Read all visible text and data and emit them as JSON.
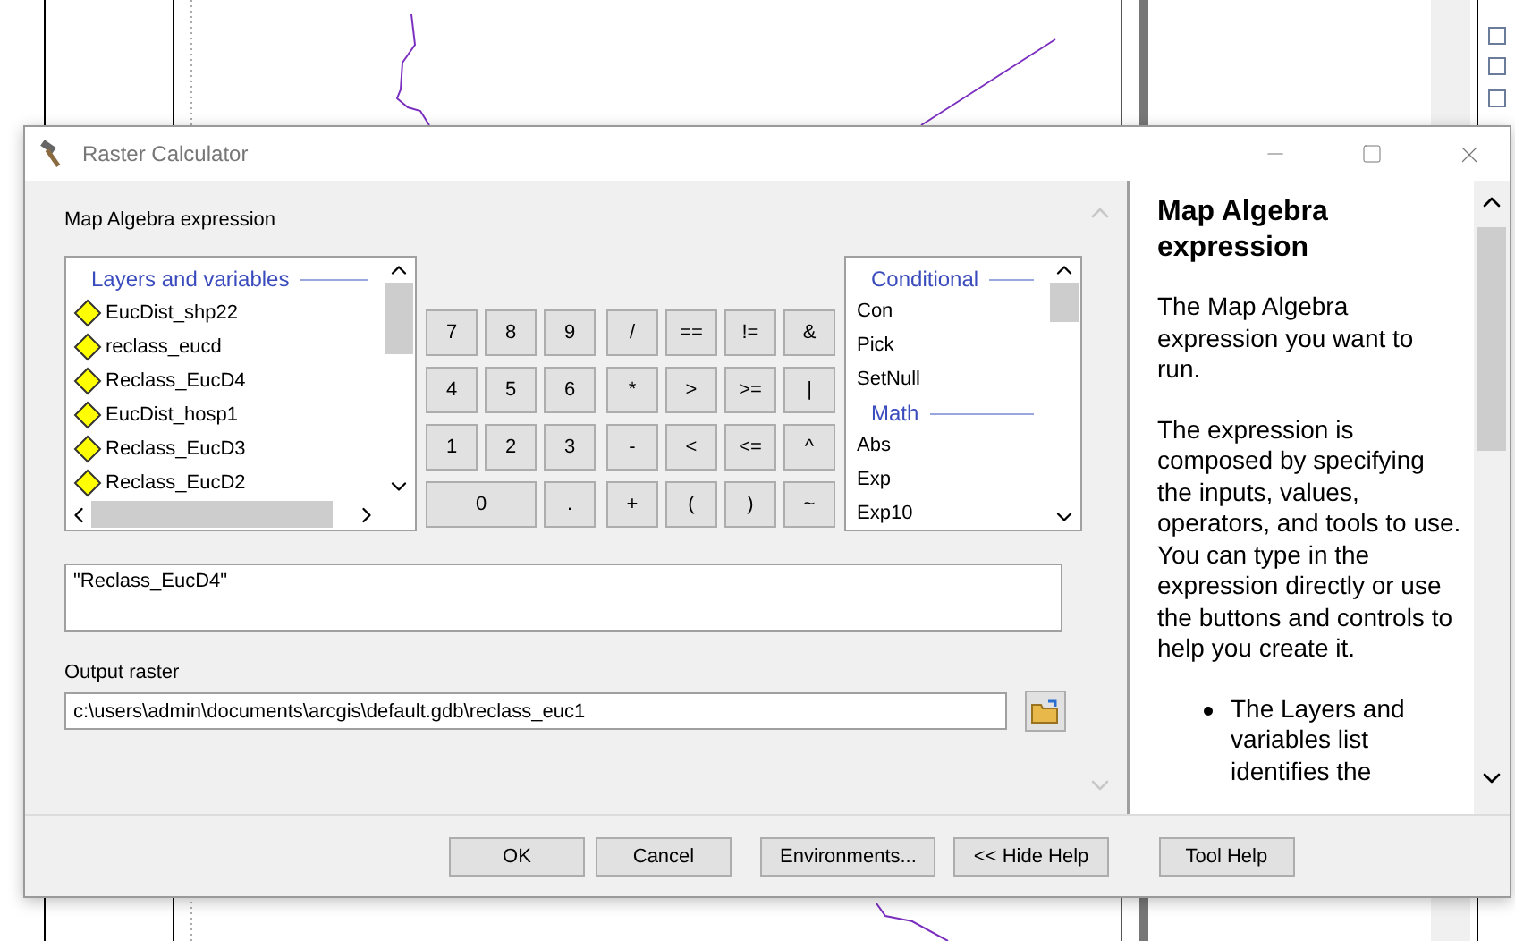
{
  "window": {
    "title": "Raster Calculator"
  },
  "expression_label": "Map Algebra expression",
  "layers_list": {
    "header": "Layers and variables",
    "items": [
      "EucDist_shp22",
      "reclass_eucd",
      "Reclass_EucD4",
      "EucDist_hosp1",
      "Reclass_EucD3",
      "Reclass_EucD2"
    ]
  },
  "keypad": {
    "digits": [
      {
        "label": "7",
        "kind": "normal"
      },
      {
        "label": "8",
        "kind": "normal"
      },
      {
        "label": "9",
        "kind": "normal"
      },
      {
        "label": "4",
        "kind": "normal"
      },
      {
        "label": "5",
        "kind": "normal"
      },
      {
        "label": "6",
        "kind": "normal"
      },
      {
        "label": "1",
        "kind": "normal"
      },
      {
        "label": "2",
        "kind": "normal"
      },
      {
        "label": "3",
        "kind": "normal"
      },
      {
        "label": "0",
        "kind": "wide"
      },
      {
        "label": ".",
        "kind": "normal"
      }
    ],
    "operators": [
      "/",
      "==",
      "!=",
      "&",
      "*",
      ">",
      ">=",
      "|",
      "-",
      "<",
      "<=",
      "^",
      "+",
      "(",
      ")",
      "~"
    ]
  },
  "functions_list": {
    "groups": [
      {
        "header": "Conditional",
        "items": [
          "Con",
          "Pick",
          "SetNull"
        ]
      },
      {
        "header": "Math",
        "items": [
          "Abs",
          "Exp",
          "Exp10"
        ]
      }
    ]
  },
  "expression": {
    "value": "\"Reclass_EucD4\""
  },
  "output_raster": {
    "label": "Output raster",
    "value": "c:\\users\\admin\\documents\\arcgis\\default.gdb\\reclass_euc1"
  },
  "help": {
    "title": "Map Algebra expression",
    "paragraphs": [
      "The Map Algebra expression you want to run.",
      "The expression is composed by specifying the inputs, values, operators, and tools to use. You can type in the expression directly or use the buttons and controls to help you create it."
    ],
    "bullets": [
      "The Layers and variables list identifies the"
    ]
  },
  "buttons": [
    "OK",
    "Cancel",
    "Environments...",
    "<< Hide Help",
    "Tool Help"
  ]
}
